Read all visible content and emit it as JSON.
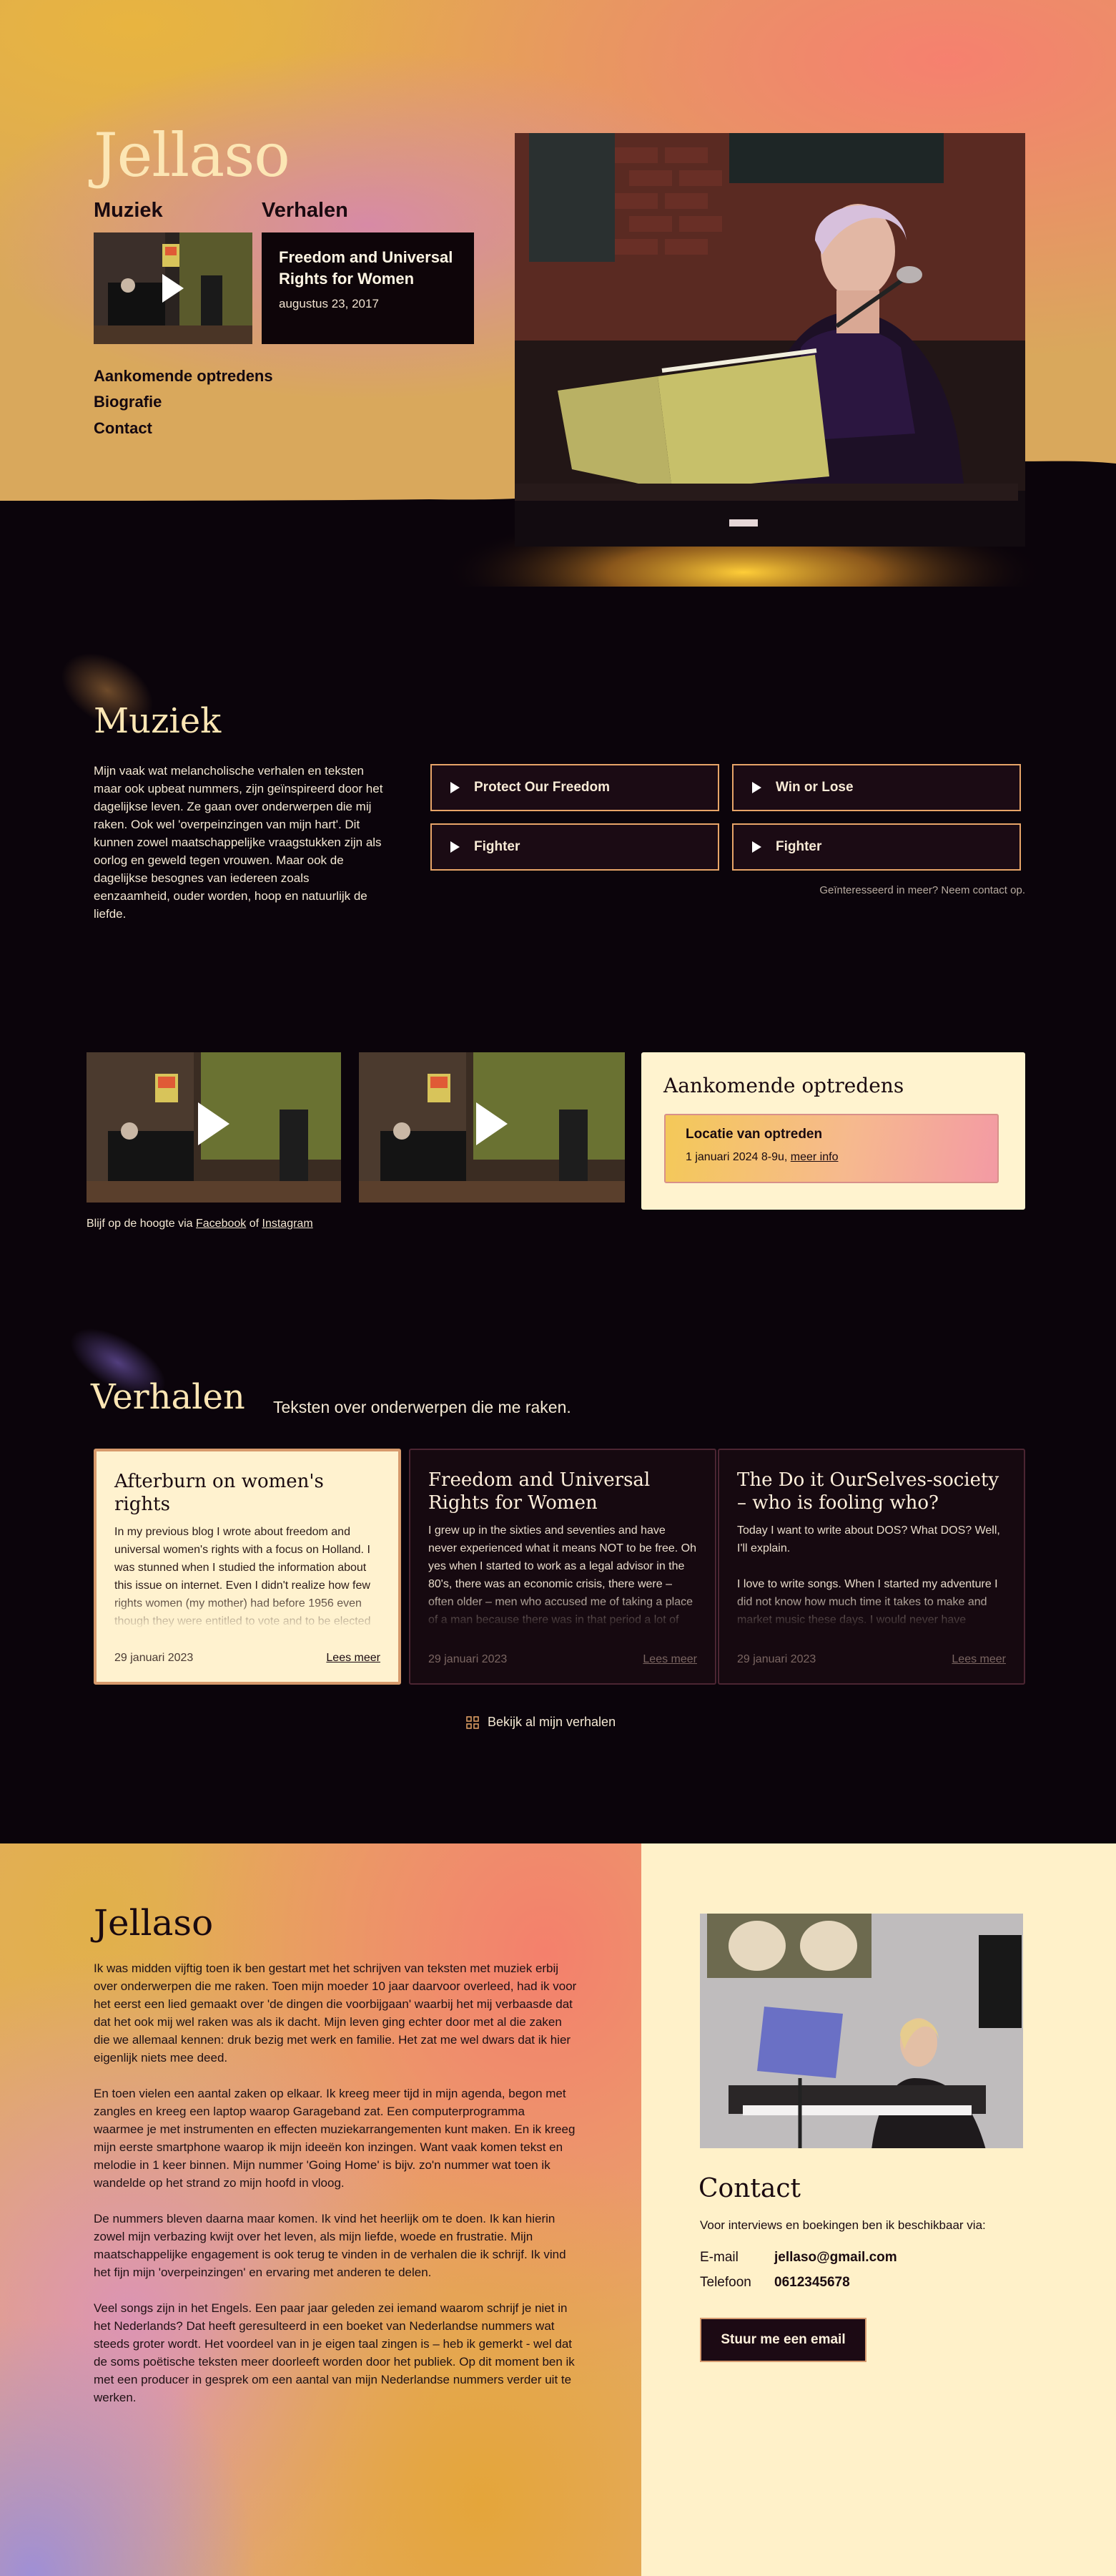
{
  "site": {
    "title": "Jellaso"
  },
  "hero": {
    "music_heading": "Muziek",
    "stories_heading": "Verhalen",
    "latest_story": {
      "title": "Freedom and Universal Rights for Women",
      "date": "augustus 23, 2017"
    },
    "nav": [
      "Aankomende optredens",
      "Biografie",
      "Contact"
    ]
  },
  "muziek": {
    "title": "Muziek",
    "text": "Mijn vaak wat melancholische verhalen en teksten maar ook upbeat nummers, zijn geïnspireerd door het dagelijkse leven. Ze gaan over onderwerpen die mij raken. Ook wel 'overpeinzingen van mijn hart'. Dit kunnen zowel maatschappelijke vraagstukken zijn als oorlog en geweld tegen vrouwen. Maar ook de dagelijkse besognes van iedereen zoals eenzaamheid, ouder worden, hoop en natuurlijk de liefde.",
    "tracks": [
      "Protect Our Freedom",
      "Win or Lose",
      "Fighter",
      "Fighter"
    ],
    "more_prefix": "Geïnteresseerd in meer?",
    "more_link": "Neem contact op",
    "more_suffix": "."
  },
  "social": {
    "prefix": "Blijf op de hoogte via",
    "facebook": "Facebook",
    "of": "of",
    "instagram": "Instagram"
  },
  "gigs": {
    "title": "Aankomende optredens",
    "item": {
      "name": "Locatie van optreden",
      "when": "1 januari 2024 8-9u,",
      "link": "meer info"
    }
  },
  "verhalen": {
    "title": "Verhalen",
    "subtitle": "Teksten over onderwerpen die me raken.",
    "read_more": "Lees meer",
    "all_link": "Bekijk al mijn verhalen",
    "stories": [
      {
        "title": "Afterburn on women's rights",
        "excerpt": "In my previous blog I wrote about freedom and universal women's rights with a focus on Holland. I was stunned when I studied the information about this issue on internet. Even I didn't realize how few rights women (my mother) had before 1956 even though they were entitled to vote and to be elected since",
        "date": "29 januari 2023"
      },
      {
        "title": "Freedom and Universal Rights for Women",
        "excerpt": "I grew up in the sixties and seventies and have never experienced what it means NOT to be free. Oh yes when I started to work as a legal advisor in the 80's, there was an economic crisis, there were – often older – men who accused me of taking a place of a man because there was in that period a lot of",
        "date": "29 januari 2023"
      },
      {
        "title": "The Do it OurSelves-society – who is fooling who?",
        "excerpt": "Today I want to write about DOS? What DOS? Well, I'll explain.\n\nI love to write songs. When I started my adventure I did not know how much time it takes to make and market music these days. I would never have guessed that most of my",
        "date": "29 januari 2023"
      }
    ]
  },
  "bio": {
    "title": "Jellaso",
    "paragraphs": [
      "Ik was midden vijftig toen ik ben gestart met het schrijven van teksten met muziek erbij over onderwerpen die me raken. Toen mijn moeder 10 jaar daarvoor overleed, had ik voor het eerst een lied gemaakt over 'de dingen die voorbijgaan' waarbij het mij verbaasde dat dat het ook mij wel raken was als ik dacht. Mijn leven ging echter door met al die zaken die we allemaal kennen: druk bezig met werk en familie. Het zat me wel dwars dat ik hier eigenlijk niets mee deed.",
      "En toen vielen een aantal zaken op elkaar. Ik kreeg meer tijd in mijn agenda, begon met zangles en kreeg een laptop waarop Garageband zat. Een computerprogramma waarmee je met instrumenten en effecten muziekarrangementen kunt maken. En ik kreeg mijn eerste smartphone waarop ik mijn ideeën kon inzingen. Want vaak komen tekst en melodie in 1 keer binnen. Mijn nummer 'Going Home' is bijv. zo'n nummer wat toen ik wandelde op het strand zo mijn hoofd in vloog.",
      "De nummers bleven daarna maar komen. Ik vind het heerlijk om te doen. Ik kan hierin zowel mijn verbazing kwijt over het leven, als mijn liefde, woede en frustratie. Mijn maatschappelijke engagement is ook terug te vinden in de verhalen die ik schrijf. Ik vind het fijn mijn 'overpeinzingen' en ervaring met anderen te delen.",
      "Veel songs zijn in het Engels. Een paar jaar geleden zei iemand waarom schrijf je niet in het Nederlands? Dat heeft geresulteerd in een boeket van Nederlandse nummers wat steeds groter wordt. Het voordeel van in je eigen taal zingen is – heb ik gemerkt - wel dat de soms poëtische teksten meer doorleeft worden door het publiek. Op dit moment ben ik met een producer in gesprek om een aantal van mijn Nederlandse nummers verder uit te werken."
    ]
  },
  "contact": {
    "title": "Contact",
    "intro": "Voor interviews en boekingen ben ik beschikbaar via:",
    "email_label": "E-mail",
    "email": "jellaso@gmail.com",
    "phone_label": "Telefoon",
    "phone": "0612345678",
    "button": "Stuur me een email"
  },
  "colors": {
    "accent": "#e7a468",
    "cream": "#fff2cf",
    "dark": "#0b040b",
    "gold": "#fce6b4"
  }
}
